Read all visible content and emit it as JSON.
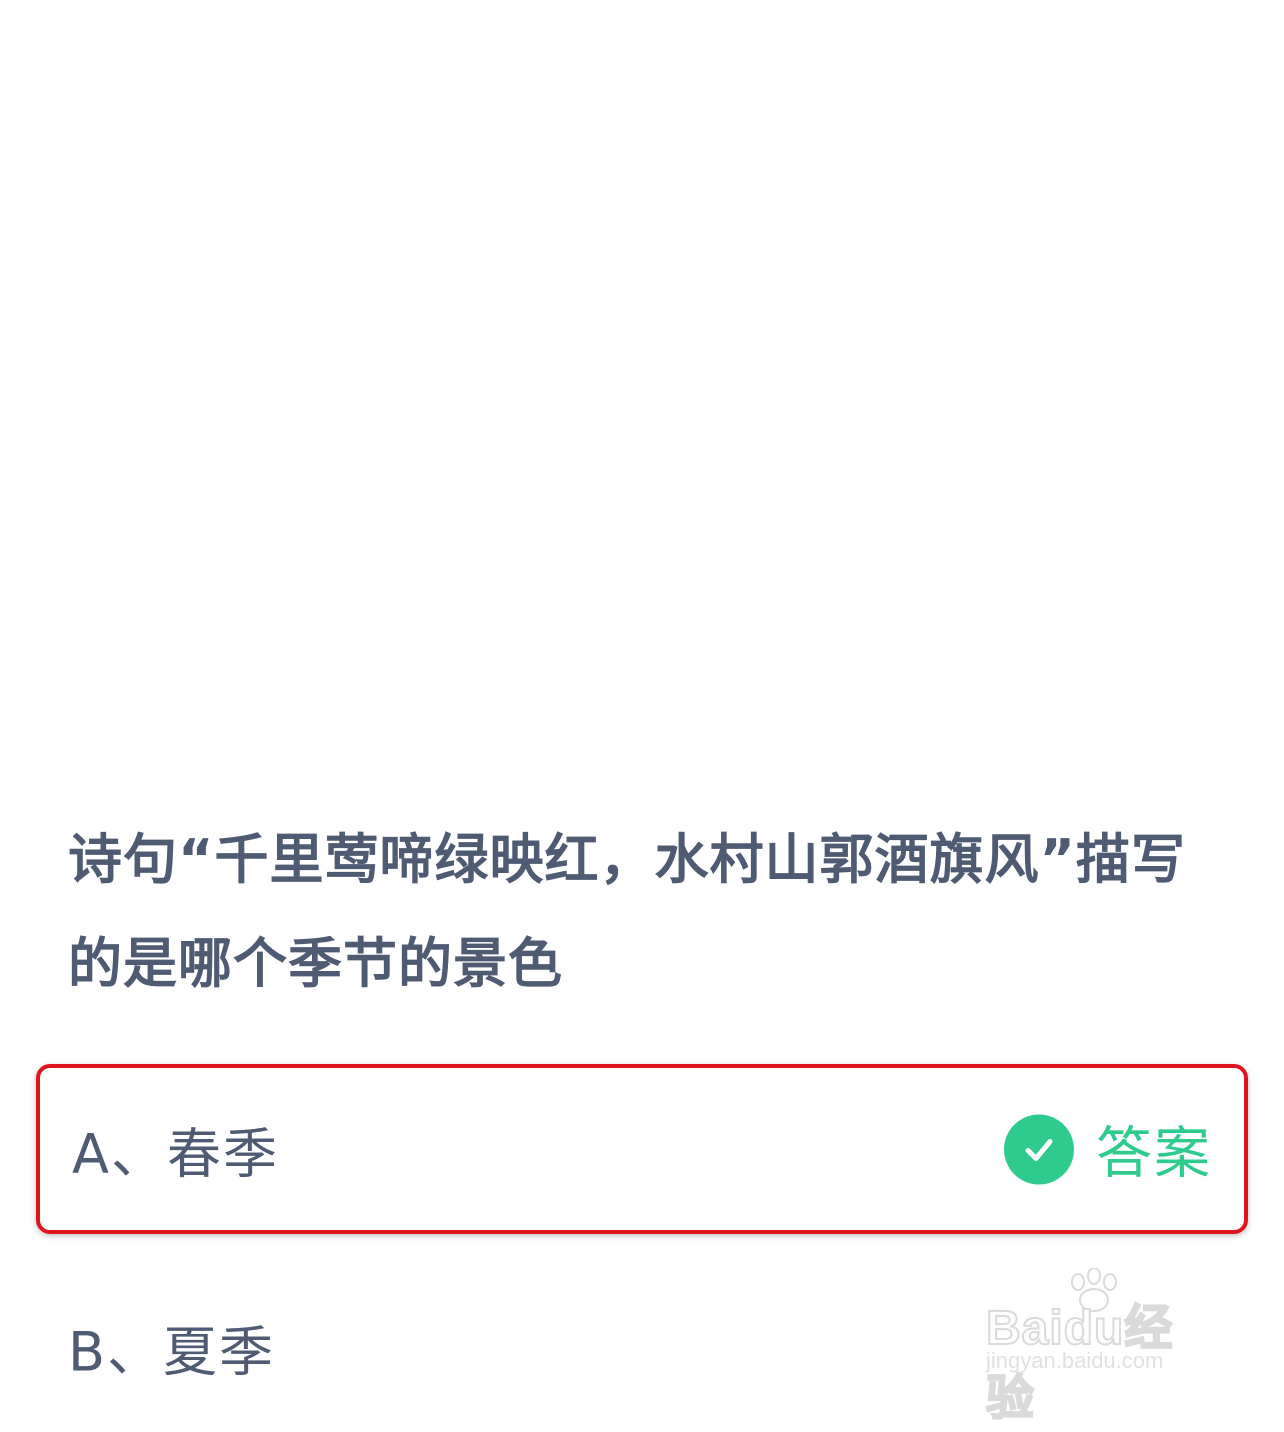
{
  "question": {
    "text": "诗句“千里莺啼绿映红，水村山郭酒旗风”描写的是哪个季节的景色"
  },
  "options": [
    {
      "label": "A、春季",
      "selected": true,
      "tag": "答案",
      "tag_icon": "check-circle-icon"
    },
    {
      "label": "B、夏季",
      "selected": false
    }
  ],
  "watermark": {
    "logo_text": "Baidu经验",
    "url": "jingyan.baidu.com"
  },
  "colors": {
    "question_text": "#4f5a73",
    "answer_green": "#2ecb8c",
    "highlight_border": "#e0141e",
    "background": "#ffffff"
  }
}
